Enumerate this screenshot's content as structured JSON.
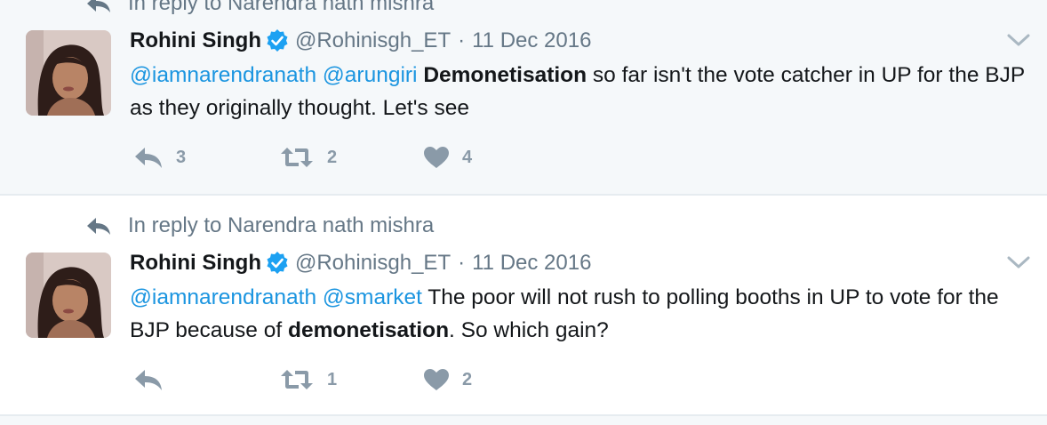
{
  "tweets": [
    {
      "reply_context": "In reply to Narendra nath mishra",
      "author_name": "Rohini Singh",
      "handle": "@Rohinisgh_ET",
      "separator": "·",
      "date": "11 Dec 2016",
      "text_segments": [
        {
          "text": "@iamnarendranath",
          "style": "mention"
        },
        {
          "text": " ",
          "style": "plain"
        },
        {
          "text": "@arungiri",
          "style": "mention"
        },
        {
          "text": " ",
          "style": "plain"
        },
        {
          "text": "Demonetisation",
          "style": "bold"
        },
        {
          "text": " so far isn't the vote catcher in UP for the BJP as they originally thought. Let's see",
          "style": "plain"
        }
      ],
      "reply_count": "3",
      "retweet_count": "2",
      "like_count": "4"
    },
    {
      "reply_context": "In reply to Narendra nath mishra",
      "author_name": "Rohini Singh",
      "handle": "@Rohinisgh_ET",
      "separator": "·",
      "date": "11 Dec 2016",
      "text_segments": [
        {
          "text": "@iamnarendranath",
          "style": "mention"
        },
        {
          "text": " ",
          "style": "plain"
        },
        {
          "text": "@smarket",
          "style": "mention"
        },
        {
          "text": " The poor will not rush to polling booths in UP to vote for the BJP because of ",
          "style": "plain"
        },
        {
          "text": "demonetisation",
          "style": "bold"
        },
        {
          "text": ". So which gain?",
          "style": "plain"
        }
      ],
      "reply_count": "",
      "retweet_count": "1",
      "like_count": "2"
    }
  ],
  "icons": {
    "reply_context": "reply-arrow-icon",
    "verified": "verified-badge-icon",
    "more": "chevron-down-icon",
    "reply": "reply-icon",
    "retweet": "retweet-icon",
    "like": "heart-icon"
  },
  "colors": {
    "mention": "#1b95e0",
    "verified": "#1da1f2",
    "secondary_text": "#657786",
    "action_gray": "#8a9aa8",
    "tweet_bg_highlight": "#f5f8fa",
    "divider": "#e6ecf0"
  }
}
